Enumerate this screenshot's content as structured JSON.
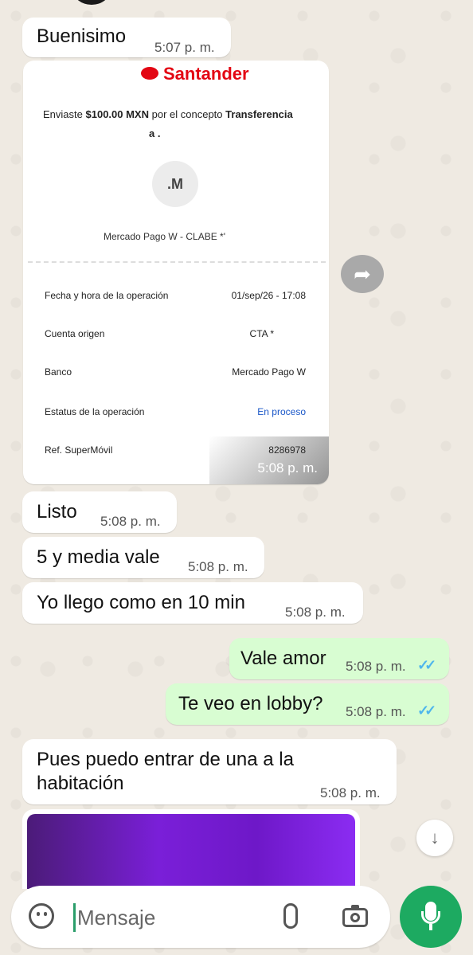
{
  "messages": [
    {
      "text": "Buenisimo",
      "time": "5:07 p. m.",
      "dir": "in"
    },
    {
      "text": "Listo",
      "time": "5:08 p. m.",
      "dir": "in"
    },
    {
      "text": "5 y media vale",
      "time": "5:08 p. m.",
      "dir": "in"
    },
    {
      "text": "Yo llego como en 10 min",
      "time": "5:08 p. m.",
      "dir": "in"
    },
    {
      "text": "Vale amor",
      "time": "5:08 p. m.",
      "dir": "out"
    },
    {
      "text": "Te veo en lobby?",
      "time": "5:08 p. m.",
      "dir": "out"
    },
    {
      "line1": "Pues puedo entrar de una a la",
      "line2": "habitación",
      "time": "5:08 p. m.",
      "dir": "in"
    }
  ],
  "receipt": {
    "brand": "Santander",
    "sent_prefix": "Enviaste",
    "amount": "$100.00 MXN",
    "concept_text": "por el concepto",
    "concept": "Transferencia",
    "recipient_prefix": "a .",
    "avatar_initials": ".M",
    "destination": "Mercado Pago W - CLABE *'",
    "rows": [
      {
        "label": "Fecha y hora de la operación",
        "value": "01/sep/26 - 17:08"
      },
      {
        "label": "Cuenta origen",
        "value": "CTA *"
      },
      {
        "label": "Banco",
        "value": "Mercado Pago W"
      },
      {
        "label": "Estatus de la operación",
        "value": "En proceso"
      },
      {
        "label": "Ref. SuperMóvil",
        "value": "8286978"
      }
    ],
    "time": "5:08 p. m."
  },
  "composer": {
    "placeholder": "Mensaje"
  },
  "colors": {
    "incoming": "#ffffff",
    "outgoing": "#d8fdd2",
    "accent": "#1daa61",
    "read_ticks": "#4fb6ec",
    "santander": "#e30613",
    "status_blue": "#1a57c8"
  },
  "icons": {
    "emoji": "sticker-emoji-icon",
    "attach": "paperclip-icon",
    "camera": "camera-icon",
    "mic": "mic-icon",
    "forward": "forward-icon",
    "scroll": "double-chevron-down-icon",
    "ticks": "double-check-icon"
  }
}
